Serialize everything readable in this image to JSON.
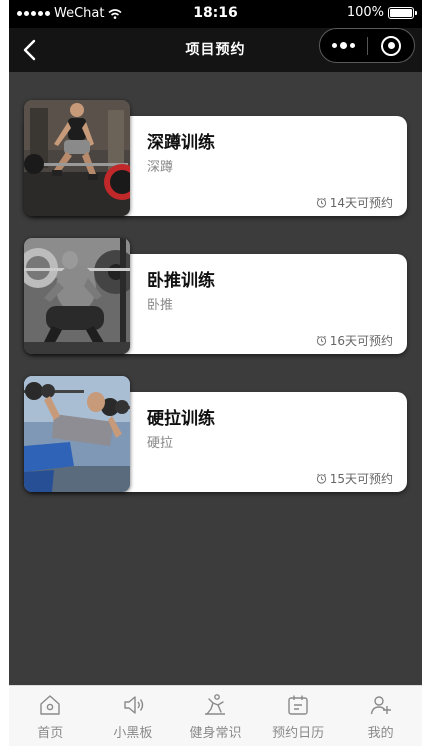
{
  "status_bar": {
    "carrier": "WeChat",
    "time": "18:16",
    "battery": "100%",
    "battery_level": 1.0
  },
  "nav": {
    "title": "项目预约"
  },
  "projects": [
    {
      "title": "深蹲训练",
      "subtitle": "深蹲",
      "availability": "14天可预约"
    },
    {
      "title": "卧推训练",
      "subtitle": "卧推",
      "availability": "16天可预约"
    },
    {
      "title": "硬拉训练",
      "subtitle": "硬拉",
      "availability": "15天可预约"
    }
  ],
  "tabbar": {
    "items": [
      {
        "label": "首页",
        "icon": "home-icon"
      },
      {
        "label": "小黑板",
        "icon": "speaker-icon"
      },
      {
        "label": "健身常识",
        "icon": "fitness-icon"
      },
      {
        "label": "预约日历",
        "icon": "calendar-icon"
      },
      {
        "label": "我的",
        "icon": "user-add-icon"
      }
    ]
  },
  "colors": {
    "page_background": "#3c3c3c",
    "nav_background": "#141414",
    "card_background": "#ffffff",
    "tab_label": "#8a8a8a"
  }
}
